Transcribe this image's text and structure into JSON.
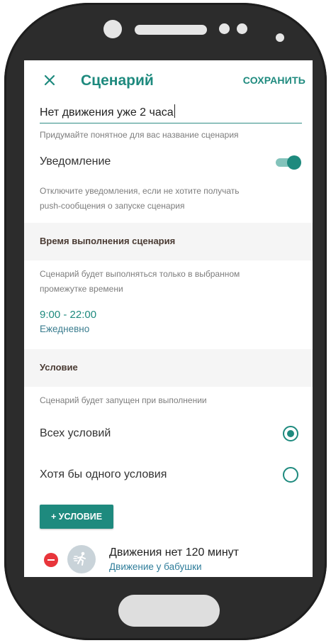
{
  "topbar": {
    "title": "Сценарий",
    "save_label": "СОХРАНИТЬ",
    "close_icon": "close-icon"
  },
  "name_field": {
    "value": "Нет движения уже 2 часа",
    "hint": "Придумайте понятное для вас название сценария"
  },
  "notification": {
    "label": "Уведомление",
    "enabled": true,
    "hint_line1": "Отключите уведомления, если не хотите получать",
    "hint_line2": "push-сообщения о запуске сценария"
  },
  "time_section": {
    "title": "Время выполнения сценария",
    "hint_line1": "Сценарий будет выполняться только в выбранном",
    "hint_line2": "промежутке времени",
    "range": "9:00 - 22:00",
    "repeat": "Ежедневно"
  },
  "condition_section": {
    "title": "Условие",
    "hint": "Сценарий будет запущен при выполнении",
    "options": [
      {
        "label": "Всех условий",
        "selected": true
      },
      {
        "label": "Хотя бы одного условия",
        "selected": false
      }
    ],
    "add_label": "+ УСЛОВИЕ"
  },
  "conditions": [
    {
      "title": "Движения нет 120 минут",
      "subtitle": "Движение у бабушки",
      "icon": "running-person-icon"
    }
  ],
  "colors": {
    "accent": "#1e8a7e",
    "phone": "#2c2c2c",
    "remove": "#e8353b",
    "section_bg": "#f5f5f5"
  }
}
